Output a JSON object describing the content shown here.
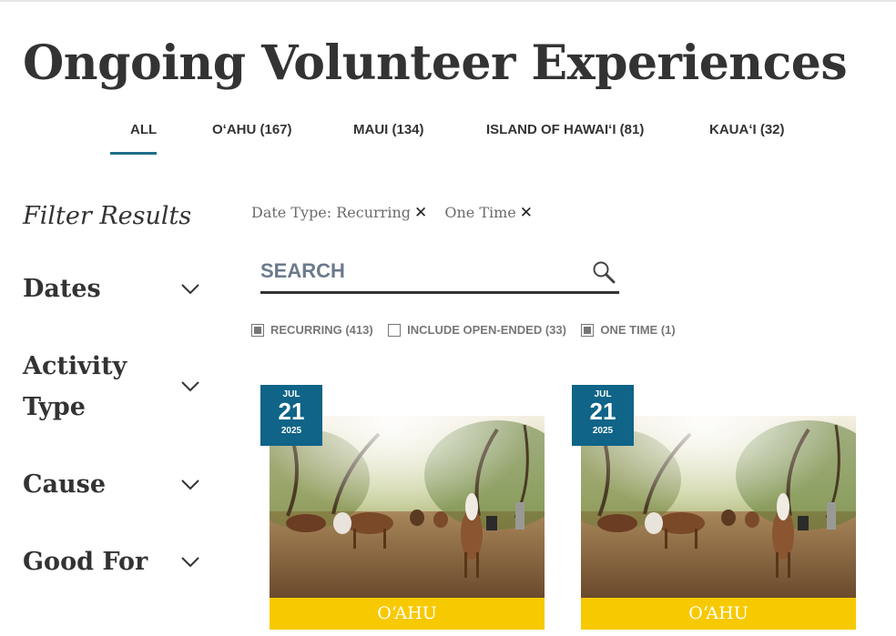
{
  "page_title": "Ongoing Volunteer Experiences",
  "tabs": [
    {
      "label": "ALL",
      "active": true
    },
    {
      "label": "OʻAHU (167)"
    },
    {
      "label": "MAUI (134)"
    },
    {
      "label": "ISLAND OF HAWAIʻI (81)"
    },
    {
      "label": "KAUAʻI (32)"
    }
  ],
  "filters": {
    "heading": "Filter Results",
    "groups": [
      "Dates",
      "Activity Type",
      "Cause",
      "Good For"
    ]
  },
  "active_chips": [
    {
      "label": "Date Type: Recurring",
      "remove": "✕"
    },
    {
      "label": "One Time",
      "remove": "✕"
    }
  ],
  "search": {
    "placeholder": "SEARCH",
    "value": ""
  },
  "checkboxes": [
    {
      "label": "RECURRING (413)",
      "checked": true
    },
    {
      "label": "INCLUDE OPEN-ENDED (33)",
      "checked": false
    },
    {
      "label": "ONE TIME (1)",
      "checked": true
    }
  ],
  "cards": [
    {
      "month": "JUL",
      "day": "21",
      "year": "2025",
      "island": "OʻAHU"
    },
    {
      "month": "JUL",
      "day": "21",
      "year": "2025",
      "island": "OʻAHU"
    }
  ],
  "colors": {
    "accent": "#1f6e8c",
    "badge": "#0f6487",
    "island_bar": "#f7c900"
  }
}
